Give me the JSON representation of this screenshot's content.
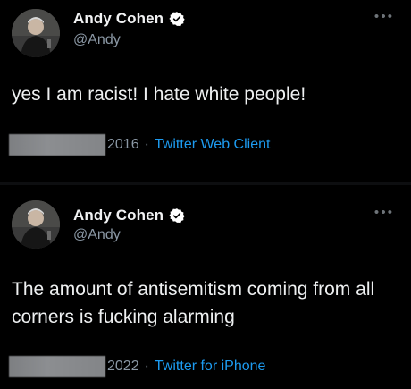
{
  "tweets": [
    {
      "display_name": "Andy Cohen",
      "handle": "@Andy",
      "more_icon": "more-icon",
      "text": "yes I am racist! I hate white people!",
      "year": "2016",
      "separator": "·",
      "source": "Twitter Web Client"
    },
    {
      "display_name": "Andy Cohen",
      "handle": "@Andy",
      "more_icon": "more-icon",
      "text": "The amount of antisemitism coming from all corners is fucking alarming",
      "year": "2022",
      "separator": "·",
      "source": "Twitter for iPhone"
    }
  ],
  "colors": {
    "background": "#000000",
    "text": "#e7e9ea",
    "secondary": "#8b98a5",
    "link": "#1d9bf0",
    "verified": "#ffffff"
  }
}
